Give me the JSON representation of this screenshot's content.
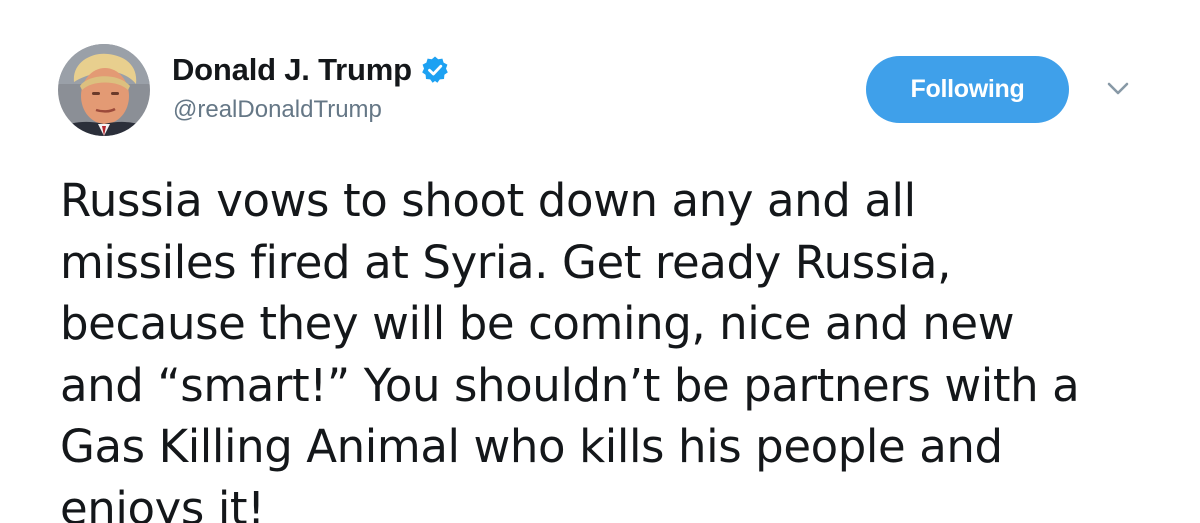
{
  "user": {
    "display_name": "Donald J. Trump",
    "handle": "@realDonaldTrump",
    "verified": true,
    "avatar": "avatar-photo"
  },
  "actions": {
    "follow_label": "Following",
    "menu_icon": "chevron-down-icon"
  },
  "tweet": {
    "lines": [
      "Russia vows to shoot down any and all",
      "missiles fired at Syria. Get ready Russia,",
      "because they will be coming, nice and new",
      "and “smart!” You shouldn’t be partners with a",
      "Gas Killing Animal who kills his people and",
      "enjoys it!"
    ]
  },
  "colors": {
    "accent": "#3fa0ea",
    "verified": "#1da1f2",
    "text": "#14171a",
    "muted": "#657786"
  }
}
